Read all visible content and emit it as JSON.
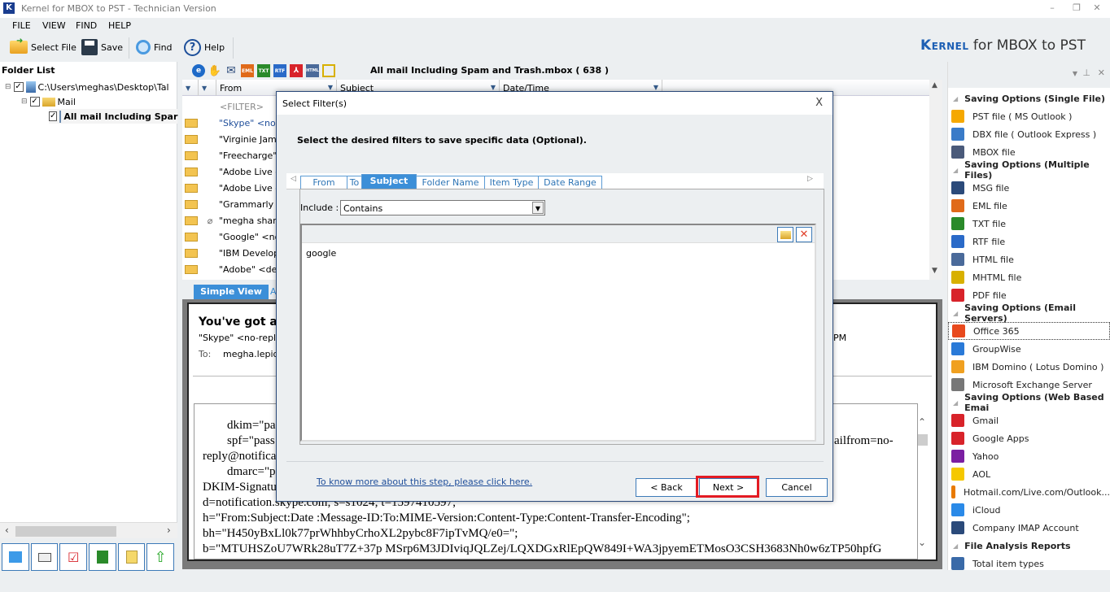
{
  "window": {
    "title": "Kernel for MBOX to PST - Technician Version",
    "logo_letter": "K",
    "minimize": "–",
    "restore": "❐",
    "close": "✕"
  },
  "menu": [
    "FILE",
    "VIEW",
    "FIND",
    "HELP"
  ],
  "toolbar": {
    "select_file": "Select File",
    "save": "Save",
    "find": "Find",
    "help": "Help"
  },
  "brand": {
    "kernel": "Kernel",
    "rest": " for MBOX to PST"
  },
  "folder_pane": {
    "header": "Folder List",
    "tree": [
      {
        "label": "C:\\Users\\meghas\\Desktop\\Tal",
        "checked": true,
        "icon": "computer-icon"
      },
      {
        "label": "Mail",
        "checked": true,
        "icon": "folder-icon"
      },
      {
        "label": "All mail Including Spar",
        "checked": true,
        "icon": "mailbox-icon",
        "selected": true
      }
    ],
    "scroll_left": "‹",
    "scroll_right": "›",
    "bottom_icons": [
      "calendar-icon",
      "contact-card-icon",
      "task-checklist-icon",
      "journal-icon",
      "notes-icon",
      "upload-arrow-icon"
    ]
  },
  "mail_list": {
    "title": "All mail Including Spam and Trash.mbox ( 638 )",
    "toolbar_icons": [
      "ie-icon",
      "hand-icon",
      "mail-icon",
      "eml-icon",
      "txt-icon",
      "rtf-icon",
      "pdf-icon",
      "html-icon",
      "mhtml-icon"
    ],
    "columns": [
      "From",
      "Subject",
      "Date/Time"
    ],
    "filter_placeholder": "<FILTER>",
    "rows": [
      {
        "from": "\"Skype\" <no-re",
        "attachment": false
      },
      {
        "from": "\"Virginie Jamou",
        "attachment": false
      },
      {
        "from": "\"Freecharge\" <",
        "attachment": false
      },
      {
        "from": "\"Adobe Live or",
        "attachment": false
      },
      {
        "from": "\"Adobe Live or",
        "attachment": false
      },
      {
        "from": "\"Grammarly Insi",
        "attachment": false
      },
      {
        "from": "\"megha sharma",
        "attachment": true
      },
      {
        "from": "\"Google\" <nore",
        "attachment": false
      },
      {
        "from": "\"IBM Develope",
        "attachment": false
      },
      {
        "from": "\"Adobe\" <dema",
        "attachment": false
      }
    ]
  },
  "preview": {
    "tab_simple": "Simple View",
    "tab_advanced": "A",
    "subject": "You've got a m",
    "from": "\"Skype\" <no-reply@",
    "time_suffix": "PM",
    "to_label": "To:",
    "to_value": "megha.lepide",
    "body_lines": [
      "dkim=\"pass",
      "spf=\"pass",
      "reply@notificat",
      "dmarc=\"pa",
      "DKIM-Signatu",
      "d=notification.skype.com; s=s1024; t=1597410597;",
      "h=\"From:Subject:Date :Message-ID:To:MIME-Version:Content-Type:Content-Transfer-Encoding\";",
      "bh=\"H450yBxLl0k77prWhhbyCrhoXL2pybc8F7ipTvMQ/e0=\";",
      "b=\"MTUHSZoU7WRk28uT7Z+37p MSrp6M3JDIviqJQLZej/LQXDGxRlEpQW849I+WA3jpyemETMosO3CSH3683Nh0w6zTP50hpfG"
    ],
    "right_fragment": "ailfrom=no-"
  },
  "right_pane": {
    "sections": [
      {
        "title": "Saving Options (Single File)",
        "items": [
          {
            "label": "PST file ( MS Outlook )",
            "icon": "pst-icon",
            "color": "#f5a800"
          },
          {
            "label": "DBX file ( Outlook Express )",
            "icon": "dbx-icon",
            "color": "#3a7bc8"
          },
          {
            "label": "MBOX file",
            "icon": "mbox-icon",
            "color": "#4a5a7a"
          }
        ]
      },
      {
        "title": "Saving Options (Multiple Files)",
        "items": [
          {
            "label": "MSG file",
            "icon": "msg-icon",
            "color": "#2b4a7a"
          },
          {
            "label": "EML file",
            "icon": "eml-icon",
            "color": "#e06a1a"
          },
          {
            "label": "TXT file",
            "icon": "txt-icon",
            "color": "#2a8a2a"
          },
          {
            "label": "RTF file",
            "icon": "rtf-icon",
            "color": "#2a6ac8"
          },
          {
            "label": "HTML file",
            "icon": "html-icon",
            "color": "#4a6a9a"
          },
          {
            "label": "MHTML file",
            "icon": "mhtml-icon",
            "color": "#d8b000"
          },
          {
            "label": "PDF file",
            "icon": "pdf-icon",
            "color": "#d8232a"
          }
        ]
      },
      {
        "title": "Saving Options (Email Servers)",
        "items": [
          {
            "label": "Office 365",
            "icon": "office365-icon",
            "color": "#e8491d",
            "selected": true
          },
          {
            "label": "GroupWise",
            "icon": "groupwise-icon",
            "color": "#2a7ad8"
          },
          {
            "label": "IBM Domino ( Lotus Domino )",
            "icon": "domino-icon",
            "color": "#f0a020"
          },
          {
            "label": "Microsoft Exchange Server",
            "icon": "exchange-icon",
            "color": "#777777"
          }
        ]
      },
      {
        "title": "Saving Options (Web Based Emai",
        "items": [
          {
            "label": "Gmail",
            "icon": "gmail-icon",
            "color": "#d8232a"
          },
          {
            "label": "Google Apps",
            "icon": "google-apps-icon",
            "color": "#d8232a"
          },
          {
            "label": "Yahoo",
            "icon": "yahoo-icon",
            "color": "#7b1fa2"
          },
          {
            "label": "AOL",
            "icon": "aol-icon",
            "color": "#f5c800"
          },
          {
            "label": "Hotmail.com/Live.com/Outlook...",
            "icon": "hotmail-icon",
            "color": "#e87a00"
          },
          {
            "label": "iCloud",
            "icon": "icloud-icon",
            "color": "#2a8ae8"
          },
          {
            "label": "Company IMAP Account",
            "icon": "imap-icon",
            "color": "#2b4a7a"
          }
        ]
      },
      {
        "title": "File Analysis Reports",
        "items": [
          {
            "label": "Total item types",
            "icon": "report-icon",
            "color": "#3a6aa8"
          }
        ]
      }
    ]
  },
  "dialog": {
    "title": "Select Filter(s)",
    "close": "X",
    "instruction": "Select the desired filters to save specific data (Optional).",
    "tabs": [
      {
        "label": "From",
        "active": false
      },
      {
        "label": "To",
        "active": false
      },
      {
        "label": "Subject",
        "active": true
      },
      {
        "label": "Folder Name",
        "active": false
      },
      {
        "label": "Item Type",
        "active": false
      },
      {
        "label": "Date Range",
        "active": false
      }
    ],
    "include_label": "Include :",
    "include_value": "Contains",
    "keywords": [
      "google"
    ],
    "help_link": "To know more about this step, please click here.",
    "back": "< Back",
    "next": "Next >",
    "cancel": "Cancel",
    "highlight_color": "#e31b23"
  }
}
